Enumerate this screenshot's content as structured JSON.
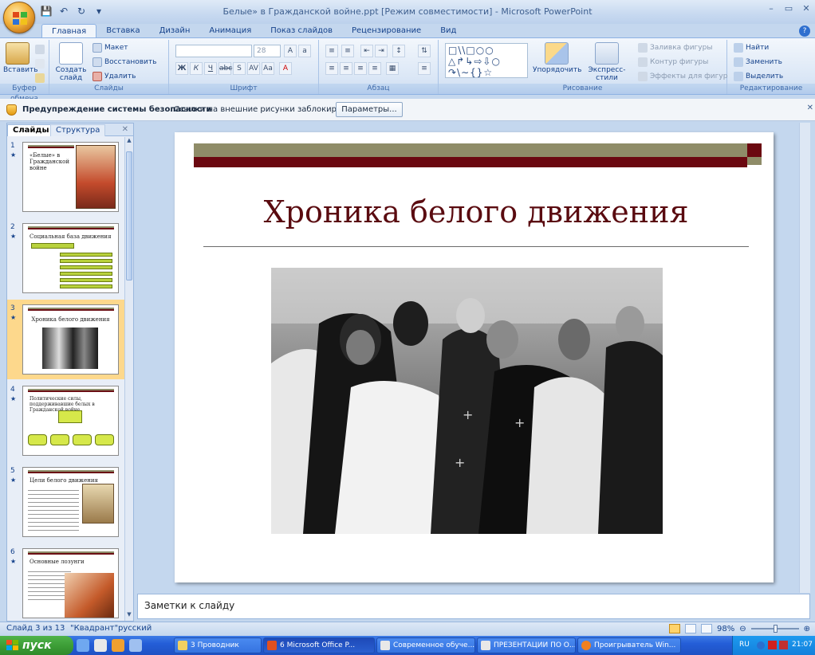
{
  "window": {
    "title": "Белые» в Гражданской войне.ppt [Режим совместимости] - Microsoft PowerPoint"
  },
  "ribbon": {
    "tabs": [
      "Главная",
      "Вставка",
      "Дизайн",
      "Анимация",
      "Показ слайдов",
      "Рецензирование",
      "Вид"
    ],
    "active_tab": "Главная",
    "clipboard": {
      "label": "Буфер обмена",
      "paste": "Вставить"
    },
    "slides": {
      "label": "Слайды",
      "create": "Создать слайд",
      "layout": "Макет",
      "reset": "Восстановить",
      "delete": "Удалить"
    },
    "font": {
      "label": "Шрифт",
      "size": "28"
    },
    "paragraph": {
      "label": "Абзац"
    },
    "drawing": {
      "label": "Рисование",
      "arrange": "Упорядочить",
      "quick_styles": "Экспресс-стили",
      "fill": "Заливка фигуры",
      "outline": "Контур фигуры",
      "effects": "Эффекты для фигур"
    },
    "editing": {
      "label": "Редактирование",
      "find": "Найти",
      "replace": "Заменить",
      "select": "Выделить"
    }
  },
  "security_bar": {
    "title": "Предупреждение системы безопасности",
    "message": "Ссылки на внешние рисунки заблокированы",
    "button": "Параметры..."
  },
  "left_pane": {
    "tab_slides": "Слайды",
    "tab_outline": "Структура",
    "thumbnails": [
      {
        "num": "1",
        "title": "«Белые» в Гражданской войне"
      },
      {
        "num": "2",
        "title": "Социальная база движения"
      },
      {
        "num": "3",
        "title": "Хроника белого движения"
      },
      {
        "num": "4",
        "title": "Политические силы, поддерживавшие белых в Гражданской войне"
      },
      {
        "num": "5",
        "title": "Цели белого движения"
      },
      {
        "num": "6",
        "title": "Основные лозунги"
      }
    ],
    "selected_index": 3
  },
  "slide": {
    "title": "Хроника белого движения",
    "colors": {
      "olive": "#8f8c68",
      "maroon": "#6b0810",
      "title": "#5a0b10"
    }
  },
  "notes": {
    "placeholder": "Заметки к слайду"
  },
  "status": {
    "slide_of": "Слайд 3 из 13",
    "theme": "\"Квадрант\"",
    "language": "русский",
    "zoom": "98%"
  },
  "taskbar": {
    "start": "пуск",
    "tasks": [
      "3 Проводник",
      "6 Microsoft Office P...",
      "Современное обуче...",
      "ПРЕЗЕНТАЦИИ ПО О...",
      "Проигрыватель Win..."
    ],
    "lang": "RU",
    "time": "21:07"
  }
}
